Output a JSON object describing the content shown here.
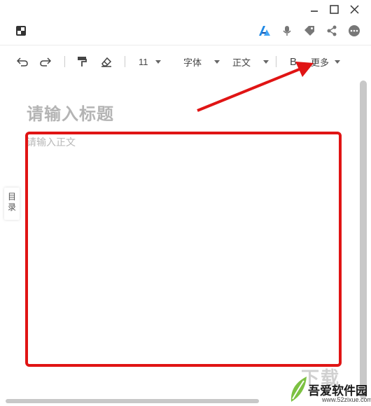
{
  "toolbar": {
    "font_size": "11",
    "font_family": "字体",
    "paragraph_style": "正文",
    "bold": "B",
    "more": "更多"
  },
  "editor": {
    "title_placeholder": "请输入标题",
    "body_placeholder": "请输入正文"
  },
  "toc": {
    "label_1": "目",
    "label_2": "录"
  },
  "watermark": {
    "text": "吾爱软件园",
    "url": "www.52zixue.com",
    "overlay": "下载"
  },
  "colors": {
    "annotation_red": "#e01414",
    "placeholder": "#b4b4b4"
  },
  "icons": [
    "minimize-icon",
    "maximize-icon",
    "close-icon",
    "sidebar-toggle-icon",
    "ai-assistant-icon",
    "microphone-icon",
    "tag-icon",
    "share-icon",
    "more-circle-icon",
    "undo-icon",
    "redo-icon",
    "format-painter-icon",
    "eraser-icon"
  ]
}
